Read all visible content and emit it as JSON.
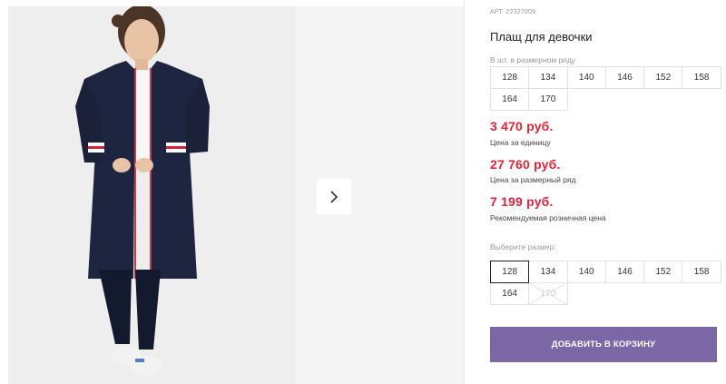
{
  "product": {
    "article": "АРТ. 22327009",
    "title": "Плащ для девочки"
  },
  "pack": {
    "label": "В шт. в размерном ряду",
    "sizes": [
      "128",
      "134",
      "140",
      "146",
      "152",
      "158",
      "164",
      "170"
    ]
  },
  "prices": {
    "unit_price": "3 470 руб.",
    "unit_label": "Цена за единицу",
    "pack_price": "27 760 руб.",
    "pack_label": "Цена за размерный ряд",
    "retail_price": "7 199 руб.",
    "retail_label": "Рекомендуемая розничная цена"
  },
  "size_select": {
    "label": "Выберите размер:",
    "sizes": [
      "128",
      "134",
      "140",
      "146",
      "152",
      "158",
      "164",
      "170"
    ],
    "selected": "128",
    "unavailable": [
      "170"
    ]
  },
  "cart": {
    "button_label": "ДОБАВИТЬ В КОРЗИНУ"
  },
  "colors": {
    "price": "#e0253b",
    "button": "#7b66a6",
    "coat": "#1d2540"
  },
  "icons": {
    "next": "chevron-right-icon"
  }
}
